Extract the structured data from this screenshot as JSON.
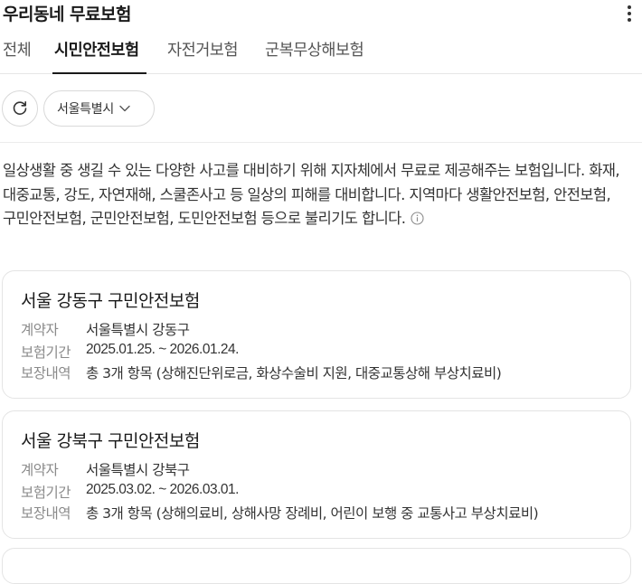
{
  "header": {
    "title": "우리동네 무료보험"
  },
  "tabs": [
    {
      "label": "전체"
    },
    {
      "label": "시민안전보험"
    },
    {
      "label": "자전거보험"
    },
    {
      "label": "군복무상해보험"
    }
  ],
  "active_tab": "시민안전보험",
  "filters": {
    "region": "서울특별시"
  },
  "description": "일상생활 중 생길 수 있는 다양한 사고를 대비하기 위해 지자체에서 무료로 제공해주는 보험입니다. 화재, 대중교통, 강도, 자연재해, 스쿨존사고 등 일상의 피해를 대비합니다. 지역마다 생활안전보험, 안전보험, 구민안전보험, 군민안전보험, 도민안전보험 등으로 불리기도 합니다.",
  "field_labels": {
    "contractor": "계약자",
    "period": "보험기간",
    "coverage": "보장내역"
  },
  "cards": [
    {
      "title": "서울 강동구 구민안전보험",
      "contractor": "서울특별시 강동구",
      "period": "2025.01.25. ~ 2026.01.24.",
      "coverage": "총 3개 항목 (상해진단위로금, 화상수술비 지원, 대중교통상해 부상치료비)"
    },
    {
      "title": "서울 강북구 구민안전보험",
      "contractor": "서울특별시 강북구",
      "period": "2025.03.02. ~ 2026.03.01.",
      "coverage": "총 3개 항목 (상해의료비, 상해사망 장례비, 어린이 보행 중 교통사고 부상치료비)"
    }
  ]
}
